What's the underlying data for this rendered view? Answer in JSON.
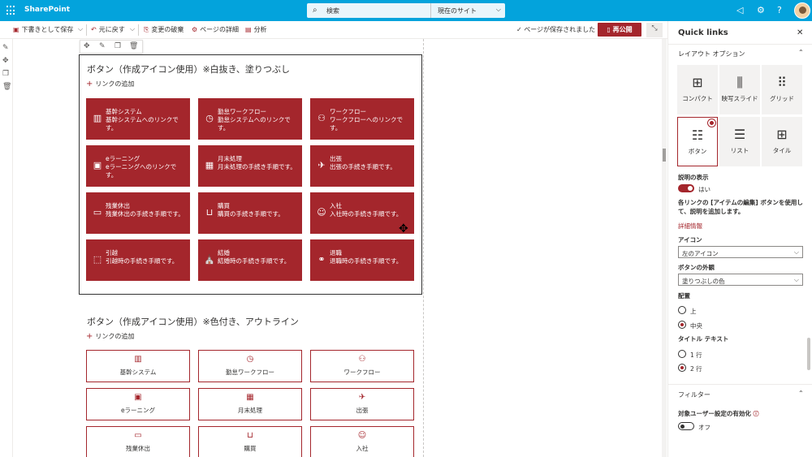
{
  "suitebar": {
    "brand": "SharePoint",
    "search_placeholder": "検索",
    "search_scope": "現在のサイト"
  },
  "commandbar": {
    "save_draft": "下書きとして保存",
    "undo": "元に戻す",
    "discard": "変更の破棄",
    "page_details": "ページの詳細",
    "analytics": "分析",
    "saved_status": "ページが保存されました",
    "publish": "再公開"
  },
  "section1": {
    "title": "ボタン（作成アイコン使用）※白抜き、塗りつぶし",
    "add_link": "リンクの追加",
    "tiles": [
      {
        "title": "基幹システム",
        "desc": "基幹システムへのリンクです。",
        "icon": "building-icon"
      },
      {
        "title": "勤怠ワークフロー",
        "desc": "勤怠システムへのリンクです。",
        "icon": "clock-icon"
      },
      {
        "title": "ワークフロー",
        "desc": "ワークフローへのリンクです。",
        "icon": "people-icon"
      },
      {
        "title": "eラーニング",
        "desc": "eラーニングへのリンクです。",
        "icon": "learning-icon"
      },
      {
        "title": "月末処理",
        "desc": "月末処理の手続き手順です。",
        "icon": "calendar-icon"
      },
      {
        "title": "出張",
        "desc": "出張の手続き手順です。",
        "icon": "plane-icon"
      },
      {
        "title": "残業休出",
        "desc": "残業休出の手続き手順です。",
        "icon": "keyboard-icon"
      },
      {
        "title": "購買",
        "desc": "購買の手続き手順です。",
        "icon": "basket-icon"
      },
      {
        "title": "入社",
        "desc": "入社時の手続き手順です。",
        "icon": "new-employee-icon"
      },
      {
        "title": "引越",
        "desc": "引越時の手続き手順です。",
        "icon": "moving-icon"
      },
      {
        "title": "結婚",
        "desc": "結婚時の手続き手順です。",
        "icon": "wedding-icon"
      },
      {
        "title": "退職",
        "desc": "退職時の手続き手順です。",
        "icon": "handshake-icon"
      }
    ]
  },
  "section2": {
    "title": "ボタン（作成アイコン使用）※色付き、アウトライン",
    "add_link": "リンクの追加",
    "tiles": [
      {
        "label": "基幹システム",
        "icon": "building-icon"
      },
      {
        "label": "勤怠ワークフロー",
        "icon": "clock-icon"
      },
      {
        "label": "ワークフロー",
        "icon": "people-icon"
      },
      {
        "label": "eラーニング",
        "icon": "learning-icon"
      },
      {
        "label": "月末処理",
        "icon": "calendar-icon"
      },
      {
        "label": "出張",
        "icon": "plane-icon"
      },
      {
        "label": "残業休出",
        "icon": "keyboard-icon"
      },
      {
        "label": "購買",
        "icon": "basket-icon"
      },
      {
        "label": "入社",
        "icon": "new-employee-icon"
      }
    ]
  },
  "pane": {
    "title": "Quick links",
    "layout_section": "レイアウト オプション",
    "layouts": [
      {
        "label": "コンパクト",
        "icon": "compact-icon",
        "glyph": "⊞"
      },
      {
        "label": "映写スライド",
        "icon": "filmstrip-icon",
        "glyph": "⫼"
      },
      {
        "label": "グリッド",
        "icon": "grid-icon",
        "glyph": "⠿"
      },
      {
        "label": "ボタン",
        "icon": "button-layout-icon",
        "glyph": "☷"
      },
      {
        "label": "リスト",
        "icon": "list-icon",
        "glyph": "☰"
      },
      {
        "label": "タイル",
        "icon": "tile-icon",
        "glyph": "⊞"
      }
    ],
    "show_desc_label": "説明の表示",
    "show_desc_value": "はい",
    "help_text": "各リンクの [アイテムの編集] ボタンを使用して、説明を追加します。",
    "more_info": "詳細情報",
    "icon_label": "アイコン",
    "icon_value": "左のアイコン",
    "appearance_label": "ボタンの外観",
    "appearance_value": "塗りつぶしの色",
    "align_label": "配置",
    "align_top": "上",
    "align_center": "中央",
    "title_text_label": "タイトル テキスト",
    "title_1line": "1 行",
    "title_2line": "2 行",
    "filter_section": "フィルター",
    "audience_label": "対象ユーザー設定の有効化",
    "audience_value": "オフ"
  },
  "colors": {
    "suitebar": "#03a3dc",
    "accent": "#a4262c"
  }
}
